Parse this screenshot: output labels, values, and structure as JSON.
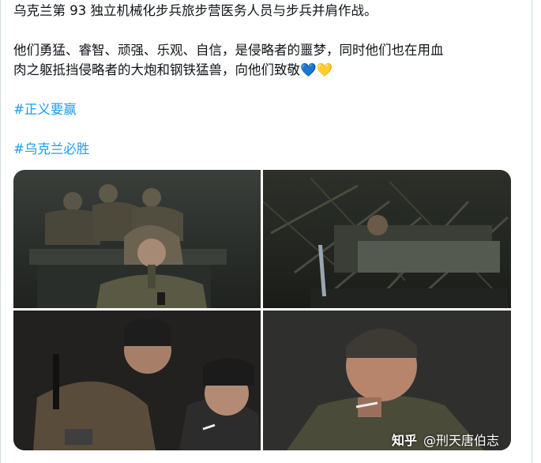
{
  "tweet": {
    "line1": "乌克兰第 93 独立机械化步兵旅步营医务人员与步兵并肩作战。",
    "line2": "他们勇猛、睿智、顽强、乐观、自信，是侵略者的噩梦，同时他们也在用血",
    "line3_text": "肉之躯抵挡侵略者的大炮和钢铁猛兽，向他们致敬",
    "line3_emoji": "💙💛",
    "hashtags": [
      "#正义要赢",
      "#乌克兰必胜"
    ]
  },
  "watermark": {
    "brand": "知乎",
    "author": "@刑天唐伯志"
  },
  "colors": {
    "text": "#0f1419",
    "hashtag": "#1d9bf0"
  }
}
